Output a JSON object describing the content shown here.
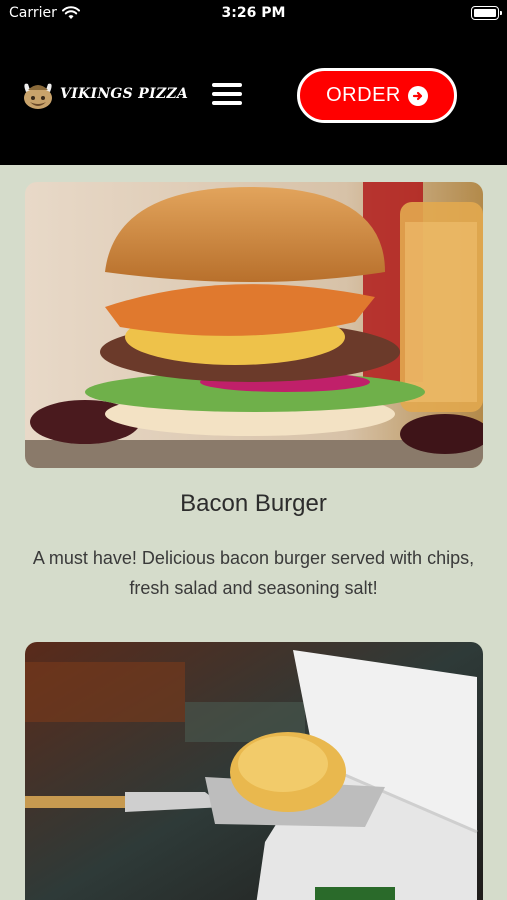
{
  "status_bar": {
    "carrier": "Carrier",
    "time": "3:26 PM"
  },
  "header": {
    "brand": "VIKINGS PIZZA",
    "order_label": "ORDER",
    "order_color": "#ff0000"
  },
  "icons": [
    "wifi-icon",
    "battery-icon",
    "viking-logo-icon",
    "hamburger-menu-icon",
    "arrow-circle-right-icon"
  ],
  "menu_items": [
    {
      "title": "Bacon Burger",
      "description": "A must have! Delicious bacon burger served with chips, fresh salad and seasoning salt!",
      "image": "bacon-burger-photo"
    },
    {
      "title": "",
      "description": "",
      "image": "calzone-pizza-box-photo"
    }
  ],
  "colors": {
    "background": "#d5dccb",
    "header": "#000000",
    "accent": "#ff0000"
  }
}
